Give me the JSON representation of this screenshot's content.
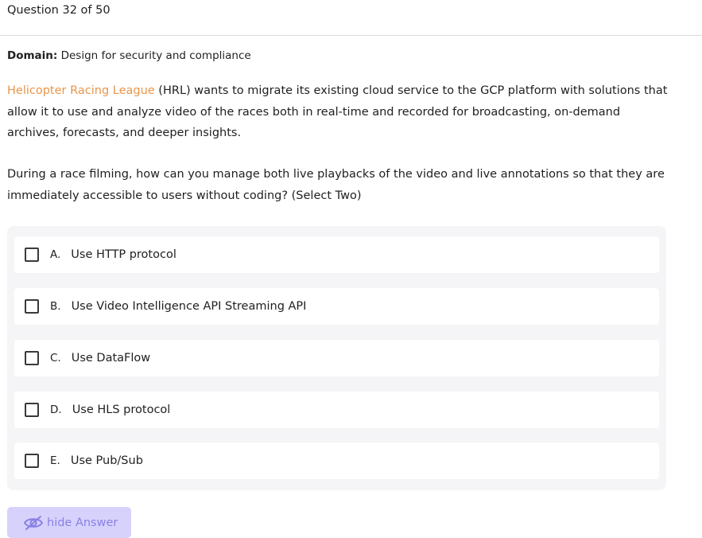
{
  "header": {
    "question_counter": "Question 32 of 50"
  },
  "domain": {
    "label": "Domain:",
    "value": "Design for security and compliance"
  },
  "scenario": {
    "company": "Helicopter Racing League",
    "text": " (HRL) wants to migrate its existing cloud service to the GCP platform with solutions that allow it to use and analyze video of the races both in real-time and recorded for broadcasting, on-demand archives, forecasts, and deeper insights."
  },
  "prompt": {
    "text": "During a race filming, how can you manage both live playbacks of the video and live annotations so that they are immediately accessible to users without coding? (Select Two)"
  },
  "options": [
    {
      "letter": "A.",
      "text": "Use HTTP protocol"
    },
    {
      "letter": "B.",
      "text": "Use Video Intelligence API Streaming API"
    },
    {
      "letter": "C.",
      "text": "Use DataFlow"
    },
    {
      "letter": "D.",
      "text": "Use HLS protocol"
    },
    {
      "letter": "E.",
      "text": "Use Pub/Sub"
    }
  ],
  "answer_toggle": {
    "label": "hide Answer",
    "icon": "eye-slash-icon"
  },
  "colors": {
    "company_link": "#e8954a",
    "button_bg": "#d6d2fb",
    "button_text": "#8a80e6",
    "panel_bg": "#f5f5f7"
  }
}
